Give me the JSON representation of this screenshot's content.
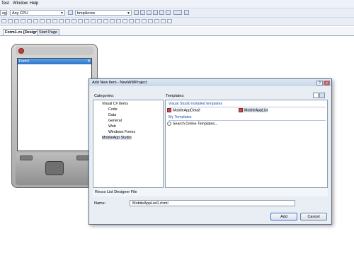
{
  "menu": {
    "items": [
      "Test",
      "Window",
      "Help"
    ]
  },
  "toolbar": {
    "config_value": "og",
    "platform_value": "Any CPU",
    "target_value": "bmpArrow"
  },
  "doc_tabs": [
    "Form1.cs [Design]",
    "Start Page"
  ],
  "form": {
    "title": "Form1",
    "close": "ok"
  },
  "dialog": {
    "title": "Add New Item - NewWMProject",
    "help_glyph": "?",
    "close_glyph": "x",
    "categories_label": "Categories:",
    "templates_label": "Templates:",
    "categories": [
      "Visual C# Items",
      "Code",
      "Data",
      "General",
      "Web",
      "Windows Forms",
      "MobileApp Studio"
    ],
    "vs_templates_header": "Visual Studio installed templates",
    "vs_templates": [
      "MobileAppDetail",
      "MobileAppList"
    ],
    "my_templates_header": "My Templates",
    "my_templates": [
      "Search Online Templates..."
    ],
    "description": "Resco List Designer File",
    "name_label": "Name:",
    "name_value": "MobileAppList1.rlxml",
    "add_label": "Add",
    "cancel_label": "Cancel"
  }
}
